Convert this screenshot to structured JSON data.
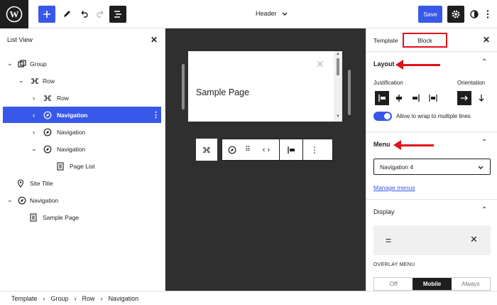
{
  "header": {
    "title": "Header",
    "save_label": "Save"
  },
  "list_view": {
    "title": "List View",
    "items": [
      {
        "label": "Group"
      },
      {
        "label": "Row"
      },
      {
        "label": "Row"
      },
      {
        "label": "Navigation"
      },
      {
        "label": "Navigation"
      },
      {
        "label": "Navigation"
      },
      {
        "label": "Page List"
      },
      {
        "label": "Site Title"
      },
      {
        "label": "Navigation"
      },
      {
        "label": "Sample Page"
      }
    ]
  },
  "canvas": {
    "preview_text": "Sample Page"
  },
  "sidebar": {
    "tabs": [
      {
        "label": "Template"
      },
      {
        "label": "Block"
      }
    ],
    "layout": {
      "title": "Layout",
      "justification_label": "Justification",
      "orientation_label": "Orientation",
      "wrap_label": "Allow to wrap to multiple lines"
    },
    "menu": {
      "title": "Menu",
      "selected": "Navigation 4",
      "manage_link": "Manage menus"
    },
    "display": {
      "title": "Display",
      "overlay_label": "OVERLAY MENU",
      "overlay_options": [
        "Off",
        "Mobile",
        "Always"
      ]
    }
  },
  "breadcrumb": [
    "Template",
    "Group",
    "Row",
    "Navigation"
  ],
  "colors": {
    "accent": "#3858e9",
    "annotation": "#e0111a",
    "canvas": "#2f2f2f"
  }
}
